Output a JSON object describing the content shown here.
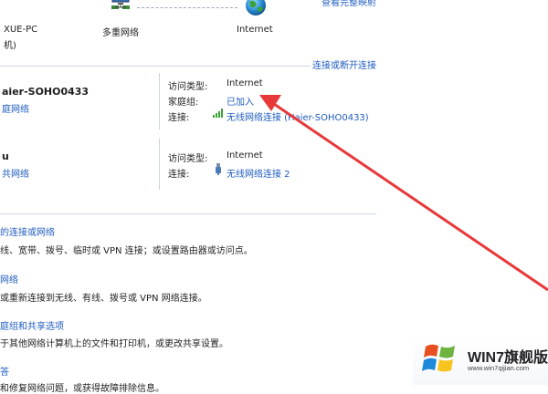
{
  "header": {
    "top_right_link": "查看完整映射",
    "computer_label_line1": "XUE-PC",
    "computer_label_line2": "机)",
    "network_label": "多重网络",
    "internet_label": "Internet",
    "connect_disconnect_link": "连接或断开连接"
  },
  "network1": {
    "name": "aier-SOHO0433",
    "type_link": "庭网络",
    "access_type_label": "访问类型:",
    "access_type_value": "Internet",
    "homegroup_label": "家庭组:",
    "homegroup_value": "已加入",
    "connection_label": "连接:",
    "connection_value": "无线网络连接 (Haier-SOHO0433)"
  },
  "network2": {
    "name": "u",
    "type_link": "共网络",
    "access_type_label": "访问类型:",
    "access_type_value": "Internet",
    "connection_label": "连接:",
    "connection_value": "无线网络连接 2"
  },
  "tasks": [
    {
      "title": "的连接或网络",
      "desc": "线、宽带、拨号、临时或 VPN 连接；或设置路由器或访问点。"
    },
    {
      "title": "网络",
      "desc": "或重新连接到无线、有线、拨号或 VPN 网络连接。"
    },
    {
      "title": "庭组和共享选项",
      "desc": "于其他网络计算机上的文件和打印机，或更改共享设置。"
    },
    {
      "title": "答",
      "desc": "和修复网络问题，或获得故障排除信息。"
    }
  ],
  "watermark": {
    "brand": "WIN7旗舰版",
    "url": "www.win7qijian.com"
  },
  "colors": {
    "link": "#1f5cc0",
    "arrow": "#e8393a",
    "separator": "#cfd8e4"
  }
}
